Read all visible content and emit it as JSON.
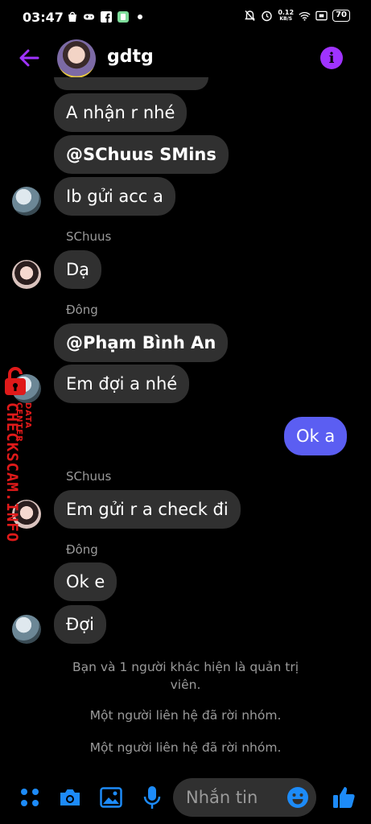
{
  "status_bar": {
    "time": "03:47",
    "left_icons": [
      "shopee-bag-icon",
      "gamepad-icon",
      "facebook-icon",
      "app-icon",
      "dot-icon"
    ],
    "net_speed_value": "0.12",
    "net_speed_unit": "KB/S",
    "battery": "70"
  },
  "header": {
    "title": "gdtg"
  },
  "messages": [
    {
      "text": "A nhận r nhé",
      "bold": false
    },
    {
      "text": "@SChuus SMins",
      "bold": true
    },
    {
      "text": "Ib gửi acc a",
      "bold": false
    },
    {
      "sender": "SChuus",
      "text": "Dạ"
    },
    {
      "sender": "Đông",
      "text": "@Phạm Bình An",
      "bold": true
    },
    {
      "text": "Em đợi a nhé"
    },
    {
      "text": "Ok a",
      "sent": true
    },
    {
      "sender": "SChuus",
      "text": "Em gửi r a check đi"
    },
    {
      "sender": "Đông",
      "text": "Ok e"
    },
    {
      "text": "Đợi"
    }
  ],
  "system_messages": [
    "Bạn và 1 người khác hiện là quản trị",
    "viên.",
    "Một người liên hệ đã rời nhóm.",
    "Một người liên hệ đã rời nhóm."
  ],
  "watermark": {
    "main": "CHECKSCAM.INFO",
    "sub": "DATA CENTER"
  },
  "composer": {
    "placeholder": "Nhắn tin"
  },
  "colors": {
    "accent": "#a033ff",
    "sent_bubble": "#5b5ef2",
    "received_bubble": "#303030",
    "icon_blue": "#1d8bf8"
  }
}
